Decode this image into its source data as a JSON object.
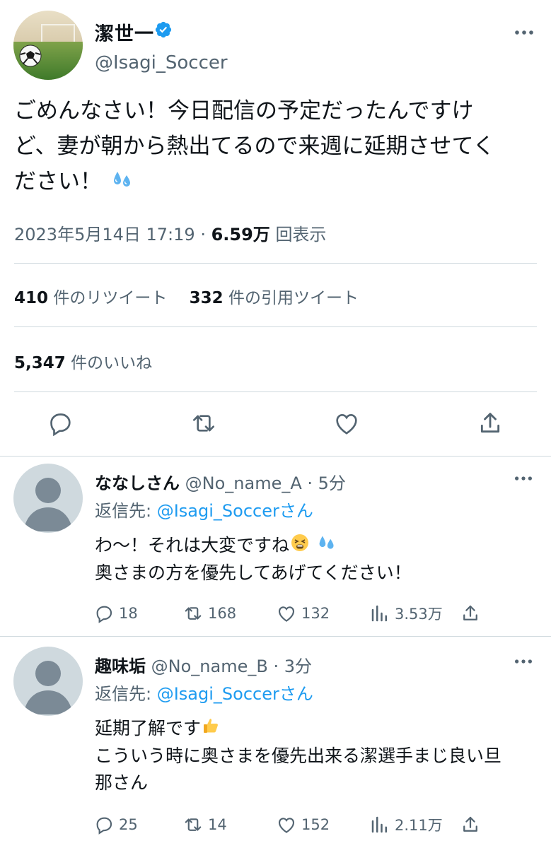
{
  "main_tweet": {
    "author": {
      "display_name": "潔世一",
      "handle": "@Isagi_Soccer",
      "verified": true
    },
    "text_lines": [
      "ごめんなさい！今日配信の予定だったんですけ",
      "ど、妻が朝から熱出てるので来週に延期させてく",
      "ださい！"
    ],
    "text_emoji": "sweat-droplets",
    "timestamp": "2023年5月14日 17:19",
    "separator": " · ",
    "views_value": "6.59万",
    "views_label": "回表示",
    "retweets_value": "410",
    "retweets_label": "件のリツイート",
    "quotes_value": "332",
    "quotes_label": "件の引用ツイート",
    "likes_value": "5,347",
    "likes_label": "件のいいね",
    "actions": [
      "reply-icon",
      "retweet-icon",
      "like-icon",
      "share-icon"
    ]
  },
  "replies": [
    {
      "display_name": "ななしさん",
      "handle": "@No_name_A",
      "time": "5分",
      "separator": " · ",
      "reply_to_prefix": "返信先: ",
      "reply_to_handle": "@Isagi_Soccerさん",
      "text_lines": [
        "わ〜！それは大変ですね",
        "奥さまの方を優先してあげてください！"
      ],
      "emojis": [
        "tired-face",
        "sweat-droplets"
      ],
      "reply_count": "18",
      "retweet_count": "168",
      "like_count": "132",
      "view_count": "3.53万"
    },
    {
      "display_name": "趣味垢",
      "handle": "@No_name_B",
      "time": "3分",
      "separator": " · ",
      "reply_to_prefix": "返信先: ",
      "reply_to_handle": "@Isagi_Soccerさん",
      "text_lines": [
        "延期了解です",
        "こういう時に奥さまを優先出来る潔選手まじ良い旦",
        "那さん"
      ],
      "emojis": [
        "thumbs-up"
      ],
      "reply_count": "25",
      "retweet_count": "14",
      "like_count": "152",
      "view_count": "2.11万"
    }
  ],
  "colors": {
    "text": "#0f1419",
    "secondary": "#536471",
    "link": "#1d9bf0",
    "divider": "#cfd9de",
    "avatar_placeholder": "#cfd9de",
    "avatar_silhouette": "#7b8a96"
  }
}
